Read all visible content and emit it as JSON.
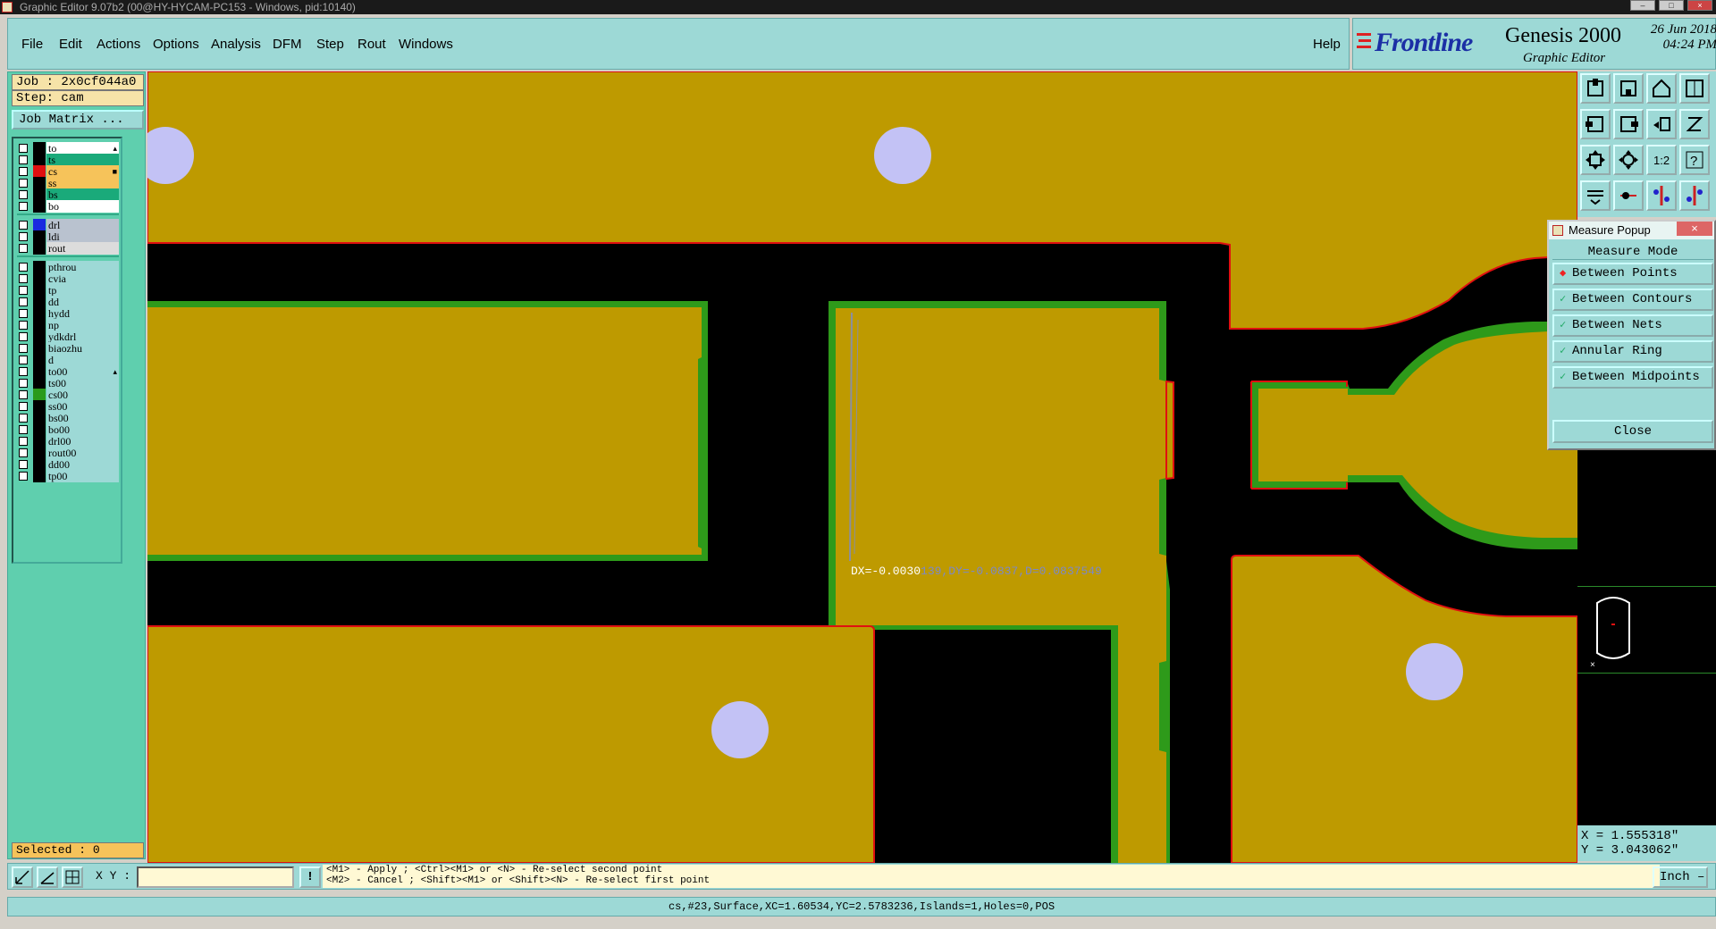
{
  "window": {
    "title": "Graphic Editor 9.07b2 (00@HY-HYCAM-PC153 - Windows, pid:10140)"
  },
  "menu": {
    "items": [
      "File",
      "Edit",
      "Actions",
      "Options",
      "Analysis",
      "DFM",
      "Step",
      "Rout",
      "Windows"
    ],
    "help": "Help"
  },
  "brand": {
    "logo": "Frontline",
    "product": "Genesis 2000",
    "subtitle": "Graphic Editor",
    "date": "26 Jun 2018",
    "time": "04:24 PM"
  },
  "job": {
    "job": "Job : 2x0cf044a0",
    "step": "Step: cam",
    "matrix_button": "Job Matrix ..."
  },
  "layers": {
    "group1": [
      {
        "name": "to",
        "color": "#ffffff",
        "swatch": "#000000",
        "marker": "▴"
      },
      {
        "name": "ts",
        "color": "#1aaa7a",
        "swatch": "#000000",
        "marker": ""
      },
      {
        "name": "cs",
        "color": "#f6c35a",
        "swatch": "#e01010",
        "marker": "■"
      },
      {
        "name": "ss",
        "color": "#f6c35a",
        "swatch": "#000000",
        "marker": ""
      },
      {
        "name": "bs",
        "color": "#1aaa7a",
        "swatch": "#000000",
        "marker": ""
      },
      {
        "name": "bo",
        "color": "#ffffff",
        "swatch": "#000000",
        "marker": ""
      }
    ],
    "group2": [
      {
        "name": "drl",
        "color": "#b9c2cf",
        "swatch": "#1a2ae0",
        "marker": ""
      },
      {
        "name": "ldi",
        "color": "#b9c2cf",
        "swatch": "#000000",
        "marker": ""
      },
      {
        "name": "rout",
        "color": "#dcdcdc",
        "swatch": "#000000",
        "marker": ""
      }
    ],
    "group3": [
      {
        "name": "pthrou",
        "color": "#9dd9d6",
        "swatch": "#000000",
        "marker": ""
      },
      {
        "name": "cvia",
        "color": "#9dd9d6",
        "swatch": "#000000",
        "marker": ""
      },
      {
        "name": "tp",
        "color": "#9dd9d6",
        "swatch": "#000000",
        "marker": ""
      },
      {
        "name": "dd",
        "color": "#9dd9d6",
        "swatch": "#000000",
        "marker": ""
      },
      {
        "name": "hydd",
        "color": "#9dd9d6",
        "swatch": "#000000",
        "marker": ""
      },
      {
        "name": "np",
        "color": "#9dd9d6",
        "swatch": "#000000",
        "marker": ""
      },
      {
        "name": "ydkdrl",
        "color": "#9dd9d6",
        "swatch": "#000000",
        "marker": ""
      },
      {
        "name": "biaozhu",
        "color": "#9dd9d6",
        "swatch": "#000000",
        "marker": ""
      },
      {
        "name": "d",
        "color": "#9dd9d6",
        "swatch": "#000000",
        "marker": ""
      },
      {
        "name": "to00",
        "color": "#9dd9d6",
        "swatch": "#000000",
        "marker": "▴"
      },
      {
        "name": "ts00",
        "color": "#9dd9d6",
        "swatch": "#000000",
        "marker": ""
      },
      {
        "name": "cs00",
        "color": "#9dd9d6",
        "swatch": "#2a9a1a",
        "marker": ""
      },
      {
        "name": "ss00",
        "color": "#9dd9d6",
        "swatch": "#000000",
        "marker": ""
      },
      {
        "name": "bs00",
        "color": "#9dd9d6",
        "swatch": "#000000",
        "marker": ""
      },
      {
        "name": "bo00",
        "color": "#9dd9d6",
        "swatch": "#000000",
        "marker": ""
      },
      {
        "name": "drl00",
        "color": "#9dd9d6",
        "swatch": "#000000",
        "marker": ""
      },
      {
        "name": "rout00",
        "color": "#9dd9d6",
        "swatch": "#000000",
        "marker": ""
      },
      {
        "name": "dd00",
        "color": "#9dd9d6",
        "swatch": "#000000",
        "marker": ""
      },
      {
        "name": "tp00",
        "color": "#9dd9d6",
        "swatch": "#000000",
        "marker": ""
      }
    ]
  },
  "selected": "Selected : 0",
  "canvas": {
    "measure_label_white": "DX=-0.0030",
    "measure_label_blue": "139,DY=-0.0837,D=0.0837549",
    "copper_color": "#be9a00",
    "pad_color": "#c3c2f5"
  },
  "measure_popup": {
    "title": "Measure Popup",
    "mode_label": "Measure Mode",
    "options": [
      {
        "label": "Between Points",
        "active": true
      },
      {
        "label": "Between Contours",
        "active": false
      },
      {
        "label": "Between Nets",
        "active": false
      },
      {
        "label": "Annular Ring",
        "active": false
      },
      {
        "label": "Between Midpoints",
        "active": false
      }
    ],
    "close": "Close"
  },
  "tools": {
    "ratio_label": "1:2",
    "help_label": "?"
  },
  "coords": {
    "x": "X = 1.555318\"",
    "y": "Y = 3.043062\""
  },
  "command": {
    "xy_label": "X Y :",
    "xy_value": "",
    "bang": "!",
    "hint_line1": "<M1> - Apply  ; <Ctrl><M1> or <N> - Re-select second point",
    "hint_line2": "<M2> - Cancel ; <Shift><M1> or <Shift><N> - Re-select first point",
    "units": "Inch"
  },
  "status": "cs,#23,Surface,XC=1.60534,YC=2.5783236,Islands=1,Holes=0,POS"
}
